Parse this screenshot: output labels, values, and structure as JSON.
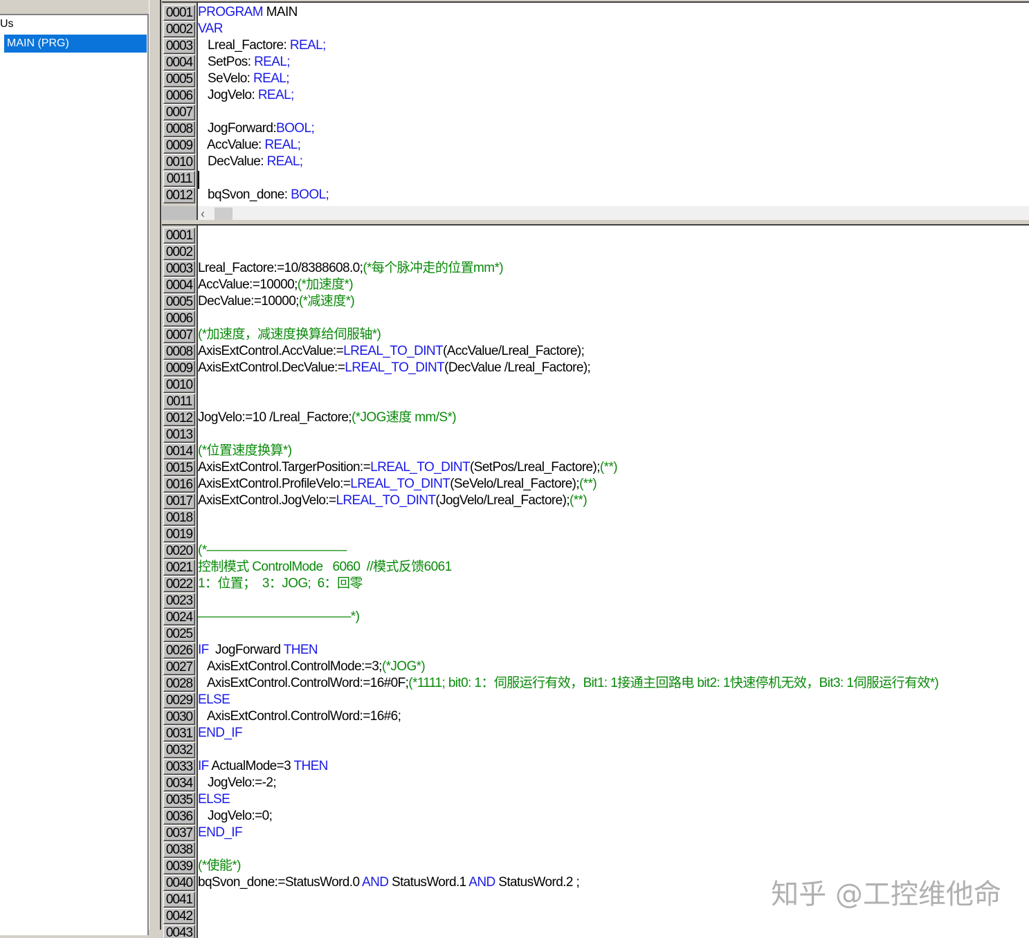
{
  "sidebar": {
    "header": "Us",
    "items": [
      {
        "label": "MAIN (PRG)",
        "selected": true
      }
    ]
  },
  "colors": {
    "keyword": "#1a1ae6",
    "comment": "#0a8a0a",
    "selection": "#0a74da"
  },
  "declaration": {
    "lines": [
      {
        "num": "0001",
        "segs": [
          [
            "k",
            "PROGRAM"
          ],
          [
            "t",
            " MAIN"
          ]
        ]
      },
      {
        "num": "0002",
        "segs": [
          [
            "k",
            "VAR"
          ]
        ]
      },
      {
        "num": "0003",
        "segs": [
          [
            "t",
            "   Lreal_Factore: "
          ],
          [
            "k",
            "REAL;"
          ]
        ]
      },
      {
        "num": "0004",
        "segs": [
          [
            "t",
            "   SetPos: "
          ],
          [
            "k",
            "REAL;"
          ]
        ]
      },
      {
        "num": "0005",
        "segs": [
          [
            "t",
            "   SeVelo: "
          ],
          [
            "k",
            "REAL;"
          ]
        ]
      },
      {
        "num": "0006",
        "segs": [
          [
            "t",
            "   JogVelo: "
          ],
          [
            "k",
            "REAL;"
          ]
        ]
      },
      {
        "num": "0007",
        "segs": []
      },
      {
        "num": "0008",
        "segs": [
          [
            "t",
            "   JogForward:"
          ],
          [
            "k",
            "BOOL;"
          ]
        ]
      },
      {
        "num": "0009",
        "segs": [
          [
            "t",
            "   AccValue: "
          ],
          [
            "k",
            "REAL;"
          ]
        ]
      },
      {
        "num": "0010",
        "segs": [
          [
            "t",
            "   DecValue: "
          ],
          [
            "k",
            "REAL;"
          ]
        ]
      },
      {
        "num": "0011",
        "segs": []
      },
      {
        "num": "0012",
        "segs": [
          [
            "t",
            "   bqSvon_done: "
          ],
          [
            "k",
            "BOOL;"
          ]
        ]
      }
    ],
    "scroll_left_icon": "‹"
  },
  "body": {
    "lines": [
      {
        "num": "0001",
        "segs": []
      },
      {
        "num": "0002",
        "segs": []
      },
      {
        "num": "0003",
        "segs": [
          [
            "t",
            "Lreal_Factore:=10/8388608.0;"
          ],
          [
            "c",
            "(*每个脉冲走的位置mm*)"
          ]
        ]
      },
      {
        "num": "0004",
        "segs": [
          [
            "t",
            "AccValue:=10000;"
          ],
          [
            "c",
            "(*加速度*)"
          ]
        ]
      },
      {
        "num": "0005",
        "segs": [
          [
            "t",
            "DecValue:=10000;"
          ],
          [
            "c",
            "(*减速度*)"
          ]
        ]
      },
      {
        "num": "0006",
        "segs": []
      },
      {
        "num": "0007",
        "segs": [
          [
            "c",
            "(*加速度，减速度换算给伺服轴*)"
          ]
        ]
      },
      {
        "num": "0008",
        "segs": [
          [
            "t",
            "AxisExtControl.AccValue:="
          ],
          [
            "k",
            "LREAL_TO_DINT"
          ],
          [
            "t",
            "(AccValue/Lreal_Factore);"
          ]
        ]
      },
      {
        "num": "0009",
        "segs": [
          [
            "t",
            "AxisExtControl.DecValue:="
          ],
          [
            "k",
            "LREAL_TO_DINT"
          ],
          [
            "t",
            "(DecValue /Lreal_Factore);"
          ]
        ]
      },
      {
        "num": "0010",
        "segs": []
      },
      {
        "num": "0011",
        "segs": []
      },
      {
        "num": "0012",
        "segs": [
          [
            "t",
            "JogVelo:=10 /Lreal_Factore;"
          ],
          [
            "c",
            "(*JOG速度 mm/S*)"
          ]
        ]
      },
      {
        "num": "0013",
        "segs": []
      },
      {
        "num": "0014",
        "segs": [
          [
            "c",
            "(*位置速度换算*)"
          ]
        ]
      },
      {
        "num": "0015",
        "segs": [
          [
            "t",
            "AxisExtControl.TargerPosition:="
          ],
          [
            "k",
            "LREAL_TO_DINT"
          ],
          [
            "t",
            "(SetPos/Lreal_Factore);"
          ],
          [
            "c",
            "(**)"
          ]
        ]
      },
      {
        "num": "0016",
        "segs": [
          [
            "t",
            "AxisExtControl.ProfileVelo:="
          ],
          [
            "k",
            "LREAL_TO_DINT"
          ],
          [
            "t",
            "(SeVelo/Lreal_Factore);"
          ],
          [
            "c",
            "(**)"
          ]
        ]
      },
      {
        "num": "0017",
        "segs": [
          [
            "t",
            "AxisExtControl.JogVelo:="
          ],
          [
            "k",
            "LREAL_TO_DINT"
          ],
          [
            "t",
            "(JogVelo/Lreal_Factore);"
          ],
          [
            "c",
            "(**)"
          ]
        ]
      },
      {
        "num": "0018",
        "segs": []
      },
      {
        "num": "0019",
        "segs": []
      },
      {
        "num": "0020",
        "segs": [
          [
            "c",
            "(*———————————"
          ]
        ]
      },
      {
        "num": "0021",
        "segs": [
          [
            "c",
            "控制模式 ControlMode   6060  //模式反馈6061"
          ]
        ]
      },
      {
        "num": "0022",
        "segs": [
          [
            "c",
            "1：位置；  3：JOG;  6：回零"
          ]
        ]
      },
      {
        "num": "0023",
        "segs": []
      },
      {
        "num": "0024",
        "segs": [
          [
            "c",
            "————————————*)"
          ]
        ]
      },
      {
        "num": "0025",
        "segs": []
      },
      {
        "num": "0026",
        "segs": [
          [
            "k",
            "IF"
          ],
          [
            "t",
            "  JogForward "
          ],
          [
            "k",
            "THEN"
          ]
        ]
      },
      {
        "num": "0027",
        "segs": [
          [
            "t",
            "   AxisExtControl.ControlMode:=3;"
          ],
          [
            "c",
            "(*JOG*)"
          ]
        ]
      },
      {
        "num": "0028",
        "segs": [
          [
            "t",
            "   AxisExtControl.ControlWord:=16#0F;"
          ],
          [
            "c",
            "(*1111; bit0: 1：伺服运行有效，Bit1: 1接通主回路电 bit2: 1快速停机无效，Bit3: 1伺服运行有效*)"
          ]
        ]
      },
      {
        "num": "0029",
        "segs": [
          [
            "k",
            "ELSE"
          ]
        ]
      },
      {
        "num": "0030",
        "segs": [
          [
            "t",
            "   AxisExtControl.ControlWord:=16#6;"
          ]
        ]
      },
      {
        "num": "0031",
        "segs": [
          [
            "k",
            "END_IF"
          ]
        ]
      },
      {
        "num": "0032",
        "segs": []
      },
      {
        "num": "0033",
        "segs": [
          [
            "k",
            "IF"
          ],
          [
            "t",
            " ActualMode=3 "
          ],
          [
            "k",
            "THEN"
          ]
        ]
      },
      {
        "num": "0034",
        "segs": [
          [
            "t",
            "   JogVelo:=-2;"
          ]
        ]
      },
      {
        "num": "0035",
        "segs": [
          [
            "k",
            "ELSE"
          ]
        ]
      },
      {
        "num": "0036",
        "segs": [
          [
            "t",
            "   JogVelo:=0;"
          ]
        ]
      },
      {
        "num": "0037",
        "segs": [
          [
            "k",
            "END_IF"
          ]
        ]
      },
      {
        "num": "0038",
        "segs": []
      },
      {
        "num": "0039",
        "segs": [
          [
            "c",
            "(*使能*)"
          ]
        ]
      },
      {
        "num": "0040",
        "segs": [
          [
            "t",
            "bqSvon_done:=StatusWord.0 "
          ],
          [
            "k",
            "AND"
          ],
          [
            "t",
            " StatusWord.1 "
          ],
          [
            "k",
            "AND"
          ],
          [
            "t",
            " StatusWord.2 ;"
          ]
        ]
      },
      {
        "num": "0041",
        "segs": []
      },
      {
        "num": "0042",
        "segs": []
      },
      {
        "num": "0043",
        "segs": []
      }
    ]
  },
  "watermark": "知乎 @工控维他命"
}
